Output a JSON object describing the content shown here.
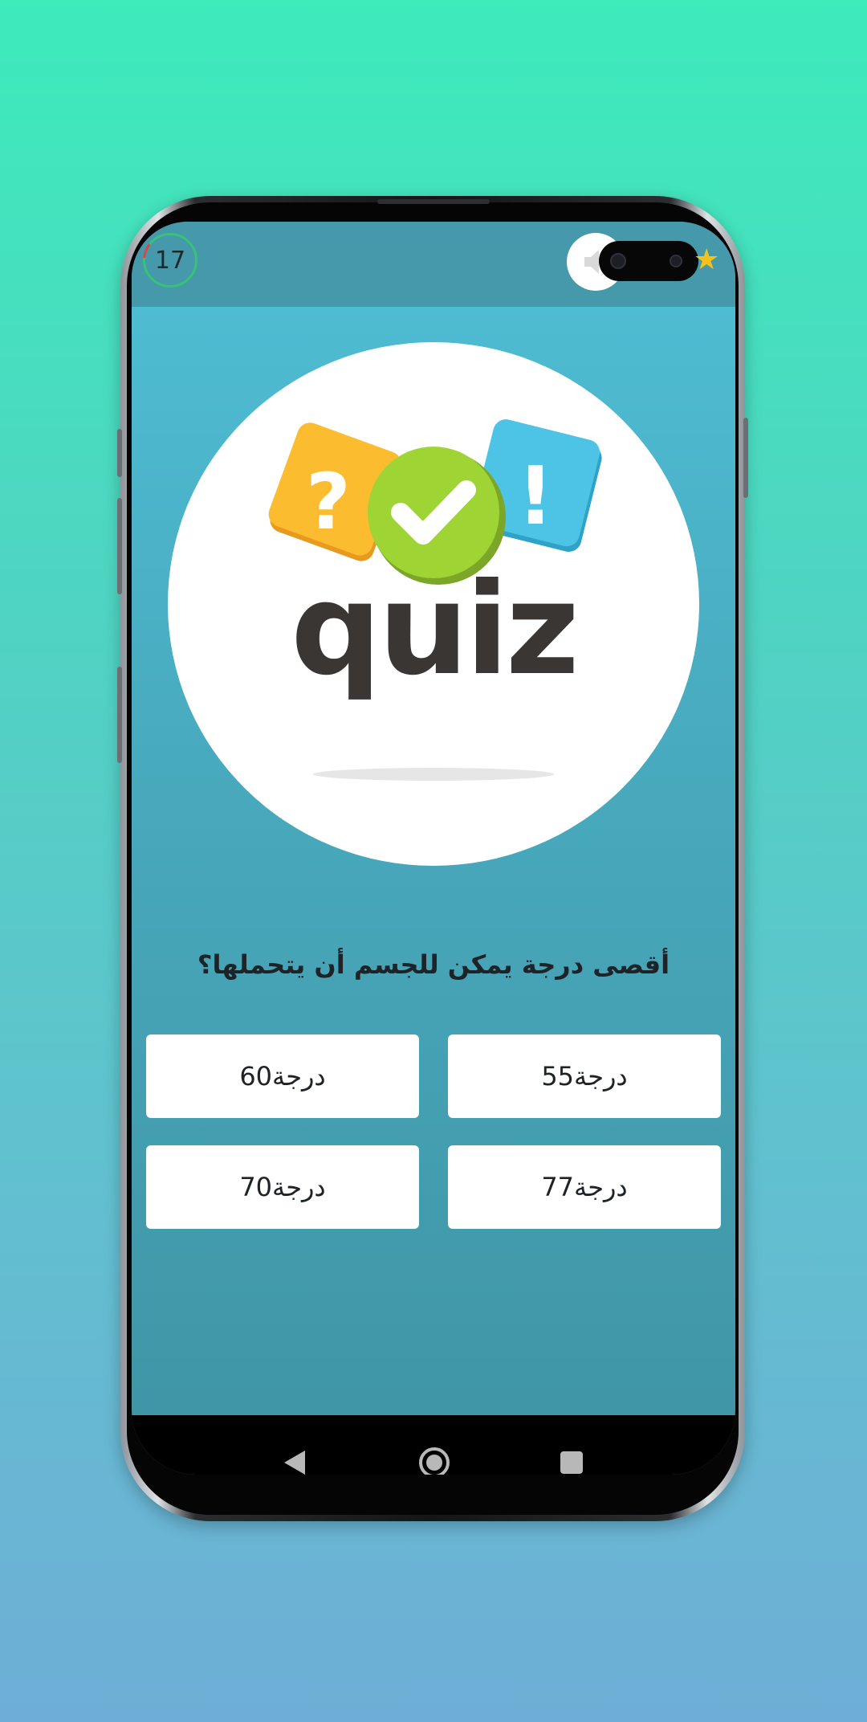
{
  "header": {
    "timer_value": "17",
    "sound_icon": "speaker-icon",
    "star_icon": "star-icon"
  },
  "logo": {
    "word": "quiz",
    "symbols": [
      "?",
      "✓",
      "!"
    ]
  },
  "question": {
    "text": "أقصى درجة يمكن للجسم أن يتحملها؟"
  },
  "answers": [
    {
      "label": "درجة55"
    },
    {
      "label": "درجة60"
    },
    {
      "label": "درجة77"
    },
    {
      "label": "درجة70"
    }
  ],
  "colors": {
    "background_top": "#3debbb",
    "background_bottom": "#6eaed6",
    "topbar": "#4599ab",
    "timer_ring": "#37c27a",
    "logo_yellow": "#fbbd2f",
    "logo_green": "#9fd435",
    "logo_blue": "#4dc3e6",
    "logo_text": "#3a3633"
  }
}
